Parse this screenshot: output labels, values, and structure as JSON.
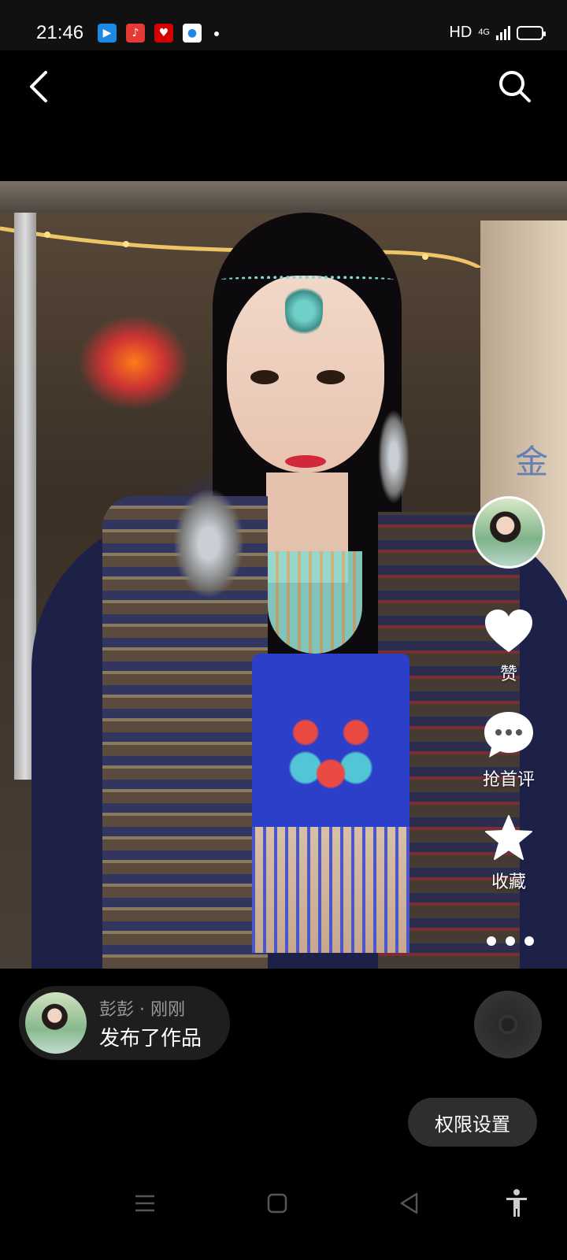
{
  "status_bar": {
    "time": "21:46",
    "notification_icons": [
      "app-icon-blue",
      "music-icon",
      "heart-icon",
      "camera-icon"
    ],
    "network_label": "HD",
    "network_type": "4G",
    "battery_level": 0.65
  },
  "header": {
    "back_icon": "chevron-left-icon",
    "search_icon": "search-icon"
  },
  "video": {
    "wall_text": "金",
    "actions": {
      "like_label": "赞",
      "comment_label": "抢首评",
      "collect_label": "收藏"
    }
  },
  "publish": {
    "meta": "彭彭 · 刚刚",
    "text": "发布了作品"
  },
  "permissions_label": "权限设置",
  "navbar": {
    "icons": [
      "menu-icon",
      "home-icon",
      "back-triangle-icon",
      "accessibility-icon"
    ]
  }
}
